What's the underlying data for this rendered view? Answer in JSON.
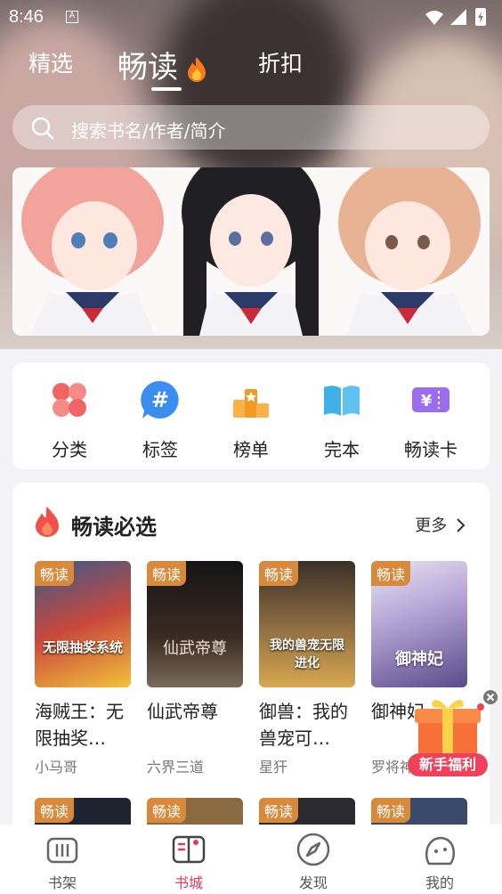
{
  "status": {
    "time": "8:46",
    "notification_letter": "A"
  },
  "tabs": [
    {
      "label": "精选",
      "active": false
    },
    {
      "label": "畅读",
      "active": true
    },
    {
      "label": "折扣",
      "active": false
    }
  ],
  "search": {
    "placeholder": "搜索书名/作者/简介"
  },
  "categories": [
    {
      "label": "分类",
      "icon": "clover-icon",
      "color": "#f06464"
    },
    {
      "label": "标签",
      "icon": "hashtag-icon",
      "color": "#3a8ef0"
    },
    {
      "label": "榜单",
      "icon": "podium-icon",
      "color": "#f4a232"
    },
    {
      "label": "完本",
      "icon": "open-book-icon",
      "color": "#3fb1e8"
    },
    {
      "label": "畅读卡",
      "icon": "yen-ticket-icon",
      "color": "#9a6cf0"
    }
  ],
  "section": {
    "title": "畅读必选",
    "more": "更多"
  },
  "books": [
    {
      "tag": "畅读",
      "title": "海贼王：无限抽奖…",
      "author": "小马哥",
      "cover_text": "无限抽奖系统"
    },
    {
      "tag": "畅读",
      "title": "仙武帝尊",
      "author": "六界三道",
      "cover_text": "仙武帝尊"
    },
    {
      "tag": "畅读",
      "title": "御兽：我的兽宠可…",
      "author": "星犴",
      "cover_text": "我的兽宠无限进化"
    },
    {
      "tag": "畅读",
      "title": "御神妃",
      "author": "罗将神",
      "cover_text": "御神妃"
    }
  ],
  "books_row2_tags": [
    "畅读",
    "畅读",
    "畅读",
    "畅读"
  ],
  "promo": {
    "label": "新手福利"
  },
  "nav": [
    {
      "label": "书架",
      "icon": "bookshelf-icon",
      "active": false
    },
    {
      "label": "书城",
      "icon": "bookstore-icon",
      "active": true
    },
    {
      "label": "发现",
      "icon": "compass-icon",
      "active": false
    },
    {
      "label": "我的",
      "icon": "profile-icon",
      "active": false
    }
  ],
  "colors": {
    "accent": "#e23b54",
    "tag": "#d88a3c"
  }
}
